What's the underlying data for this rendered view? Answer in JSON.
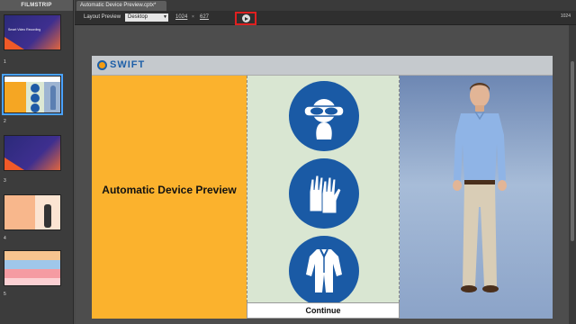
{
  "filmstrip": {
    "title": "FILMSTRIP",
    "slides": [
      {
        "number": "1",
        "caption": "Smart Video Recording"
      },
      {
        "number": "2"
      },
      {
        "number": "3"
      },
      {
        "number": "4"
      },
      {
        "number": "5"
      }
    ]
  },
  "tabs": [
    {
      "label": "Automatic Device Preview.cptx*"
    }
  ],
  "toolbar": {
    "layout_label": "Layout Preview",
    "device": "Desktop",
    "width": "1024",
    "height": "627",
    "right_value": "1024"
  },
  "slide": {
    "logo": "SWIFT",
    "heading": "Automatic Device Preview",
    "continue_label": "Continue"
  },
  "icons": [
    "goggles-icon",
    "gloves-icon",
    "protective-suit-icon",
    "play-icon"
  ],
  "colors": {
    "orange_panel": "#fbb22d",
    "green_panel": "#d9e6d2",
    "blue_panel": "#8ba3c8",
    "safety_blue": "#1a5aa5",
    "highlight_red": "#e02020"
  }
}
